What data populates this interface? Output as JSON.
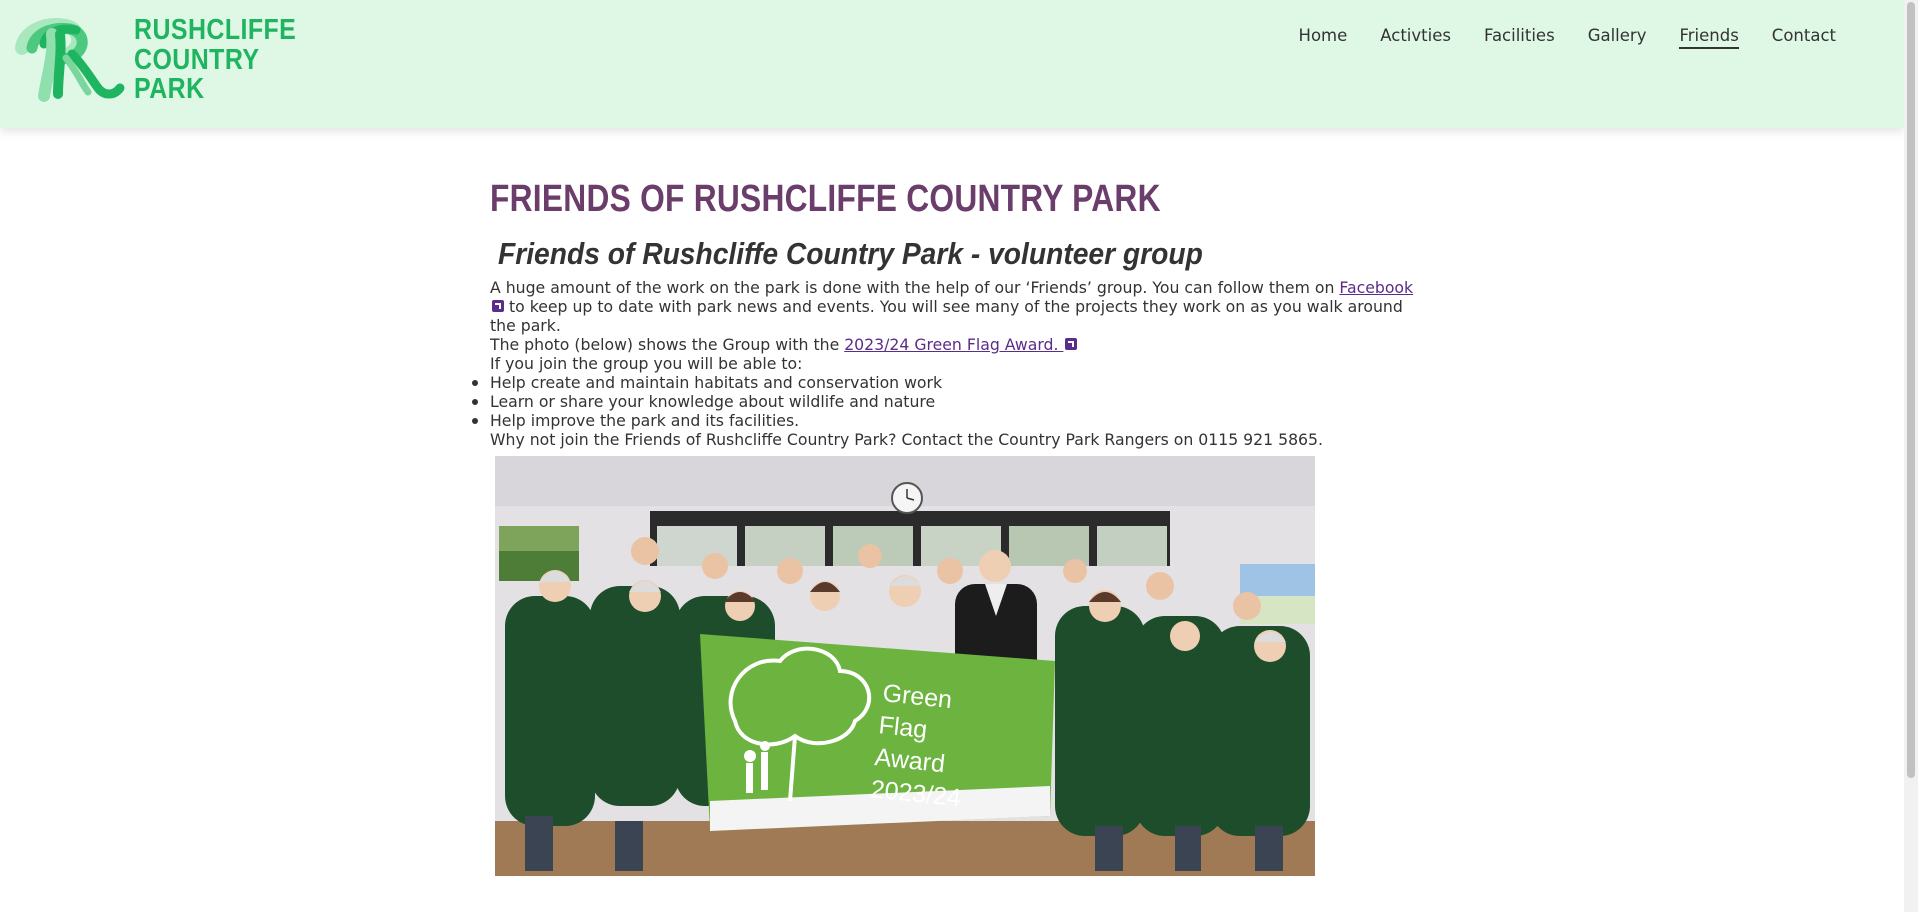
{
  "header": {
    "logo_lines": [
      "RUSHCLIFFE",
      "COUNTRY",
      "PARK"
    ]
  },
  "nav": {
    "items": [
      {
        "label": "Home"
      },
      {
        "label": "Activties"
      },
      {
        "label": "Facilities"
      },
      {
        "label": "Gallery"
      },
      {
        "label": "Friends"
      },
      {
        "label": "Contact"
      }
    ],
    "active": "Friends"
  },
  "page": {
    "title": "FRIENDS OF RUSHCLIFFE COUNTRY PARK",
    "subtitle": "Friends of Rushcliffe Country Park - volunteer group",
    "p1_before": "A huge amount of the work on the park is done with the help of our ‘Friends’ group. You can follow them on ",
    "facebook_link": "Facebook ",
    "p1_after": " to keep up to date with park news and events. You will see many of the projects they work on as you walk around the park.",
    "p2_before": "The photo (below) shows the Group with the ",
    "award_link": "2023/24 Green Flag Award. ",
    "p3": "If you join the group you will be able to:",
    "bullets": [
      "Help create and maintain habitats and conservation work",
      "Learn or share your knowledge about wildlife and nature",
      "Help improve the park and its facilities."
    ],
    "p4": "Why not join the Friends of Rushcliffe Country Park? Contact the Country Park Rangers on 0115 921 5865."
  },
  "photo": {
    "flag_lines": [
      "Green",
      "Flag",
      "Award",
      "2023/24"
    ]
  },
  "colors": {
    "header_bg": "#dff8e5",
    "brand_green": "#1fb45f",
    "title_purple": "#6b3d6b",
    "link_purple": "#5b2d8a",
    "flag_green": "#6cb33f"
  }
}
